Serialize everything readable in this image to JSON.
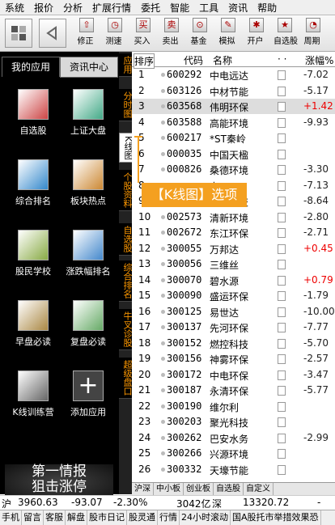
{
  "menubar": {
    "items": [
      "系统",
      "报价",
      "分析",
      "扩展行情",
      "委托",
      "智能",
      "工具",
      "资讯",
      "帮助"
    ]
  },
  "toolbar": {
    "buttons": [
      {
        "label": "修正"
      },
      {
        "label": "测速"
      },
      {
        "label": "买入"
      },
      {
        "label": "卖出"
      },
      {
        "label": "基金"
      },
      {
        "label": "模拟"
      },
      {
        "label": "开户"
      },
      {
        "label": "自选股"
      },
      {
        "label": "周期"
      }
    ]
  },
  "left_panel": {
    "tabs": [
      "我的应用",
      "资讯中心"
    ],
    "apps": [
      {
        "label": "自选股"
      },
      {
        "label": "上证大盘"
      },
      {
        "label": "综合排名"
      },
      {
        "label": "板块热点"
      },
      {
        "label": "股民学校"
      },
      {
        "label": "涨跌幅排名"
      },
      {
        "label": "早盘必读"
      },
      {
        "label": "复盘必读"
      },
      {
        "label": "K线训练营"
      },
      {
        "label": "添加应用"
      }
    ],
    "banner": {
      "line1": "第一情报",
      "line2": "狙击涨停"
    }
  },
  "vertical_tabs": [
    "应用",
    "分时图",
    "K线图",
    "个股资料",
    "自选股",
    "综合排名",
    "牛叉诊股",
    "超级盘口"
  ],
  "table": {
    "headers": {
      "seq": "排序",
      "code": "代码",
      "name": "名称",
      "extra": "· ·",
      "pct": "涨幅%"
    },
    "rows": [
      {
        "seq": "1",
        "code": "600292",
        "name": "中电远达",
        "pct": "-7.02",
        "dir": "down"
      },
      {
        "seq": "2",
        "code": "603126",
        "name": "中材节能",
        "pct": "-5.17",
        "dir": "down"
      },
      {
        "seq": "3",
        "code": "603568",
        "name": "伟明环保",
        "pct": "+1.42",
        "dir": "up",
        "selected": true
      },
      {
        "seq": "4",
        "code": "603588",
        "name": "高能环境",
        "pct": "-9.93",
        "dir": "down"
      },
      {
        "seq": "5",
        "code": "600217",
        "name": "*ST秦岭",
        "pct": "",
        "dir": "down"
      },
      {
        "seq": "6",
        "code": "000035",
        "name": "中国天楹",
        "pct": "",
        "dir": "down"
      },
      {
        "seq": "7",
        "code": "000826",
        "name": "桑德环境",
        "pct": "-3.30",
        "dir": "down"
      },
      {
        "seq": "8",
        "code": "",
        "name": "力",
        "pct": "-7.13",
        "dir": "down"
      },
      {
        "seq": "9",
        "code": "",
        "name": "新通科技",
        "pct": "-8.64",
        "dir": "down"
      },
      {
        "seq": "10",
        "code": "002573",
        "name": "清新环境",
        "pct": "-2.80",
        "dir": "down"
      },
      {
        "seq": "11",
        "code": "002672",
        "name": "东江环保",
        "pct": "-2.71",
        "dir": "down"
      },
      {
        "seq": "12",
        "code": "300055",
        "name": "万邦达",
        "pct": "+0.45",
        "dir": "up"
      },
      {
        "seq": "13",
        "code": "300056",
        "name": "三维丝",
        "pct": "",
        "dir": "down"
      },
      {
        "seq": "14",
        "code": "300070",
        "name": "碧水源",
        "pct": "+0.79",
        "dir": "up"
      },
      {
        "seq": "15",
        "code": "300090",
        "name": "盛运环保",
        "pct": "-1.79",
        "dir": "down"
      },
      {
        "seq": "16",
        "code": "300125",
        "name": "易世达",
        "pct": "-10.00",
        "dir": "down"
      },
      {
        "seq": "17",
        "code": "300137",
        "name": "先河环保",
        "pct": "-7.77",
        "dir": "down"
      },
      {
        "seq": "18",
        "code": "300152",
        "name": "燃控科技",
        "pct": "-5.70",
        "dir": "down"
      },
      {
        "seq": "19",
        "code": "300156",
        "name": "神雾环保",
        "pct": "-2.57",
        "dir": "down"
      },
      {
        "seq": "20",
        "code": "300172",
        "name": "中电环保",
        "pct": "-3.47",
        "dir": "down"
      },
      {
        "seq": "21",
        "code": "300187",
        "name": "永清环保",
        "pct": "-5.77",
        "dir": "down"
      },
      {
        "seq": "22",
        "code": "300190",
        "name": "维尔利",
        "pct": "",
        "dir": "down"
      },
      {
        "seq": "23",
        "code": "300203",
        "name": "聚光科技",
        "pct": "",
        "dir": "down"
      },
      {
        "seq": "24",
        "code": "300262",
        "name": "巴安水务",
        "pct": "-2.99",
        "dir": "down"
      },
      {
        "seq": "25",
        "code": "300266",
        "name": "兴源环境",
        "pct": "",
        "dir": "down"
      },
      {
        "seq": "26",
        "code": "300332",
        "name": "天壕节能",
        "pct": "",
        "dir": "down"
      }
    ]
  },
  "callout": {
    "text": "【K线图】选项"
  },
  "sheet_tabs": [
    "沪深",
    "中小板",
    "创业板",
    "自选股",
    "自定义"
  ],
  "status": {
    "index1": "沪",
    "val1": "3960.63",
    "chg1": "-93.07",
    "pct1": "-2.30%",
    "amt1": "3042亿",
    "index2": "深",
    "val2": "13320.72",
    "chg2": "-"
  },
  "bottom_links": [
    "手机",
    "留言",
    "客服",
    "解盘",
    "股市日记",
    "股灵通",
    "行情",
    "24小时滚动",
    "国A股托市举措效果恐"
  ]
}
